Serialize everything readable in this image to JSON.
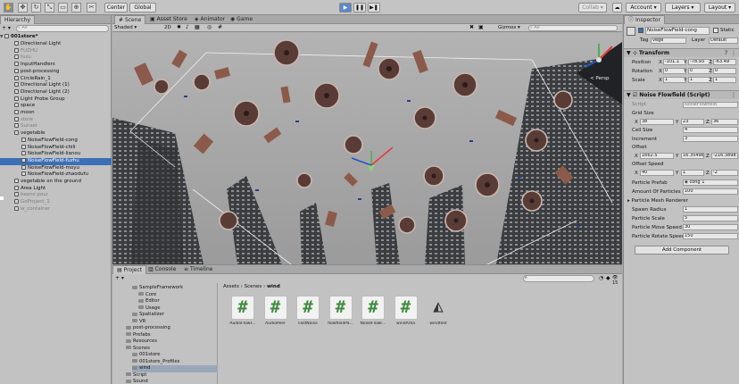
{
  "toolbar": {
    "pivot_label": "Center",
    "space_label": "Global",
    "collab_label": "Collab ▾",
    "account_label": "Account",
    "layers_label": "Layers",
    "layout_label": "Layout"
  },
  "hierarchy": {
    "tab_label": "Hierarchy",
    "create_label": "+ ▾",
    "search_placeholder": "All",
    "scene_name": "001store*",
    "items": [
      {
        "label": "Directional Light",
        "dim": false
      },
      {
        "label": "FUZHU",
        "dim": true
      },
      {
        "label": "fuzu",
        "dim": true
      },
      {
        "label": "InputHandlers",
        "dim": false
      },
      {
        "label": "post-processing",
        "dim": false
      },
      {
        "label": "CircleRain_1",
        "dim": false
      },
      {
        "label": "Directional Light (1)",
        "dim": false
      },
      {
        "label": "Directional Light (2)",
        "dim": false
      },
      {
        "label": "Light Probe Group",
        "dim": false
      },
      {
        "label": "space",
        "dim": false
      },
      {
        "label": "moon",
        "dim": false
      },
      {
        "label": "store",
        "dim": true
      },
      {
        "label": "Sunset",
        "dim": true
      },
      {
        "label": "vegetable",
        "dim": false
      },
      {
        "label": "NoiseFlowField-cong",
        "dim": false
      },
      {
        "label": "NoiseFlowField-chili",
        "dim": false
      },
      {
        "label": "NoiseFlowField-lianou",
        "dim": false
      },
      {
        "label": "NoiseFlowField-fuzhu",
        "dim": false,
        "selected": true
      },
      {
        "label": "NoiseFlowField-moyu",
        "dim": false
      },
      {
        "label": "NoiseFlowField-zhaodufu",
        "dim": false
      },
      {
        "label": "vegetable on the ground",
        "dim": false
      },
      {
        "label": "Area Light",
        "dim": false
      },
      {
        "label": "beans pour",
        "dim": true
      },
      {
        "label": "GoProject_1",
        "dim": true
      },
      {
        "label": "w_container",
        "dim": true
      }
    ]
  },
  "scene": {
    "tabs": [
      "Scene",
      "Asset Store",
      "Animator",
      "Game"
    ],
    "shading_mode": "Shaded",
    "mode_2d": "2D",
    "gizmos_label": "Gizmos",
    "search_placeholder": "All",
    "persp_label": "< Persp"
  },
  "inspector": {
    "tab_label": "Inspector",
    "object_name": "NoiseFlowField-cong",
    "static_label": "Static",
    "tag_label": "Tag",
    "tag_value": "vege",
    "layer_label": "Layer",
    "layer_value": "Default",
    "transform_title": "Transform",
    "transform": [
      {
        "label": "Position",
        "x": "-101.1",
        "y": "-78.93",
        "z": "-63.49"
      },
      {
        "label": "Rotation",
        "x": "0",
        "y": "0",
        "z": "0"
      },
      {
        "label": "Scale",
        "x": "1",
        "y": "1",
        "z": "1"
      }
    ],
    "script_title": "Noise Flowfield (Script)",
    "script_label": "Script",
    "script_value": "NoiseFlowfield",
    "grid_size_label": "Grid Size",
    "grid_size": {
      "x": "38",
      "y": "23",
      "z": "36"
    },
    "cell_size_label": "Cell Size",
    "cell_size": "4",
    "increment_label": "Increment",
    "increment": "3",
    "offset_label": "Offset",
    "offset": {
      "x": "1662.5",
      "y": "16.35498",
      "z": "-216.3898"
    },
    "offset_speed_label": "Offset Speed",
    "offset_speed": {
      "x": "40",
      "y": "1",
      "z": "-2"
    },
    "prefab_label": "Particle Prefab",
    "prefab_value": "cong 1",
    "amount_label": "Amount Of Particles",
    "amount": "100",
    "mesh_renderer_label": "Particle Mesh Renderer",
    "spawn_label": "Spawn Radius",
    "spawn": "1",
    "pscale_label": "Particle Scale",
    "pscale": "5",
    "move_label": "Particle Move Speed",
    "move": "30",
    "rotate_label": "Particle Rotate Speed",
    "rotate": "150",
    "add_component_label": "Add Component"
  },
  "project": {
    "tabs": [
      "Project",
      "Console",
      "Timeline"
    ],
    "create_label": "+ ▾",
    "breadcrumb": [
      "Assets",
      "Scenes",
      "wind"
    ],
    "count_label": "15",
    "tree": [
      {
        "label": "SampleFramework",
        "indent": 2
      },
      {
        "label": "Core",
        "indent": 3
      },
      {
        "label": "Editor",
        "indent": 3
      },
      {
        "label": "Usage",
        "indent": 3
      },
      {
        "label": "Spatializer",
        "indent": 2
      },
      {
        "label": "VR",
        "indent": 2
      },
      {
        "label": "post-processing",
        "indent": 1
      },
      {
        "label": "Prefabs",
        "indent": 1
      },
      {
        "label": "Resources",
        "indent": 1
      },
      {
        "label": "Scenes",
        "indent": 1
      },
      {
        "label": "001store",
        "indent": 2
      },
      {
        "label": "001store_Profiles",
        "indent": 2
      },
      {
        "label": "wind",
        "indent": 2,
        "selected": true
      },
      {
        "label": "Script",
        "indent": 1
      },
      {
        "label": "Sound",
        "indent": 1
      }
    ],
    "assets": [
      {
        "name": "AudioFlowF...",
        "kind": "script"
      },
      {
        "name": "AudioPeer",
        "kind": "script"
      },
      {
        "name": "FastNoise",
        "kind": "script"
      },
      {
        "name": "flowfieldPa...",
        "kind": "script"
      },
      {
        "name": "NoiseFlowF...",
        "kind": "script"
      },
      {
        "name": "windArea",
        "kind": "script"
      },
      {
        "name": "windtest",
        "kind": "unity"
      }
    ]
  },
  "colors": {
    "selection": "#3d6fb3",
    "play_button": "#5b88c8",
    "panel": "#c2c2c2"
  }
}
